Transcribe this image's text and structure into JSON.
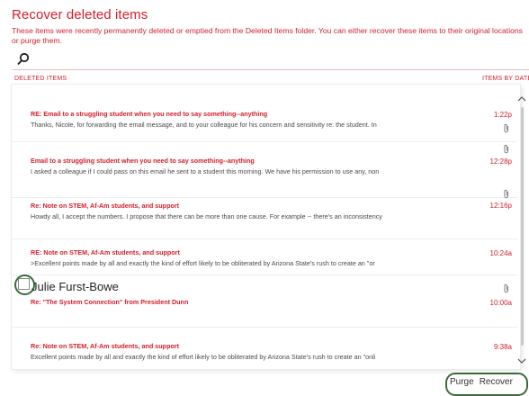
{
  "dialog": {
    "title": "Recover deleted items",
    "description": "These items were recently permanently deleted or emptied from the Deleted Items folder. You can either recover these items to their original locations or purge them.",
    "search_icon": "search-icon"
  },
  "columns": {
    "left": "DELETED ITEMS",
    "right": "ITEMS BY DATE"
  },
  "items": [
    {
      "subject": "RE: Email to a struggling student when you need to say something--anything",
      "preview": "Thanks, Nicole, for forwarding the email message, and to your colleague for his concern and sensitivity re: the student. In",
      "time": "1:22p",
      "attachment_icon": "paperclip-icon"
    },
    {
      "subject": "Email to a struggling student when you need to say something--anything",
      "preview": "I asked a colleague if I could pass on this email he sent to a student this morning. We have his permission to use any, non",
      "time": "12:28p",
      "attachment_icon": "paperclip-icon"
    },
    {
      "subject": "Re: Note on STEM, Af-Am students, and support",
      "preview": "Howdy all, I accept the numbers. I propose that there can be more than one cause. For example -- there's an inconsistency",
      "time": "12:16p",
      "attachment_icon": "paperclip-icon"
    },
    {
      "subject": "RE: Note on STEM, Af-Am students, and support",
      "preview": ">Excellent points made by all and exactly the kind of effort likely to be obliterated by Arizona State's rush to create an \"or",
      "time": "10:24a"
    },
    {
      "sender": "Julie Furst-Bowe",
      "subject": "Re: \"The System Connection\" from President Dunn",
      "time": "10:00a",
      "attachment_icon": "paperclip-icon"
    },
    {
      "subject": "Re: Note on STEM, Af-Am students, and support",
      "preview": "Excellent points made by all and exactly the kind of effort likely to be obliterated by Arizona State's rush to create an \"onli",
      "time": "9:38a"
    }
  ],
  "actions": {
    "purge": "Purge",
    "recover": "Recover"
  },
  "colors": {
    "accent": "#d21f2a",
    "annotation": "#3a6b3a"
  }
}
